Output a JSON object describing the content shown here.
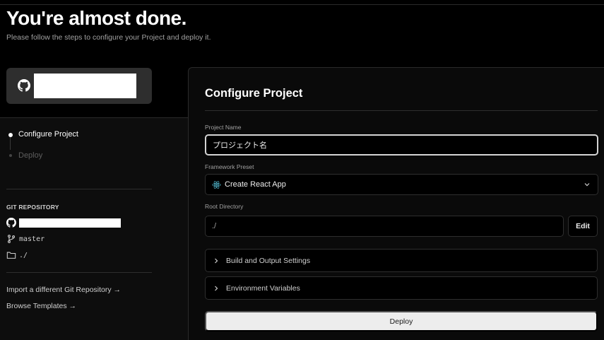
{
  "header": {
    "title": "You're almost done.",
    "subtitle": "Please follow the steps to configure your Project and deploy it."
  },
  "icons": {
    "repo_card": "github-icon",
    "repo_row": "github-icon",
    "branch_row": "git-branch-icon",
    "directory_row": "folder-icon",
    "framework": "react-icon",
    "select_caret": "chevron-down-icon",
    "accordion_caret": "chevron-right-icon"
  },
  "steps": [
    {
      "label": "Configure Project",
      "state": "active"
    },
    {
      "label": "Deploy",
      "state": "pending"
    }
  ],
  "git": {
    "heading": "GIT REPOSITORY",
    "branch": "master",
    "directory": "./"
  },
  "links": {
    "import": "Import a different Git Repository →",
    "templates": "Browse Templates →"
  },
  "config": {
    "title": "Configure Project",
    "project_name_label": "Project Name",
    "project_name_value": "プロジェクト名",
    "framework_label": "Framework Preset",
    "framework_value": "Create React App",
    "root_dir_label": "Root Directory",
    "root_dir_value": "./",
    "edit_label": "Edit",
    "build_settings_label": "Build and Output Settings",
    "env_vars_label": "Environment Variables",
    "deploy_label": "Deploy"
  },
  "colors": {
    "background": "#000000",
    "panel": "#0a0a0a",
    "deploy_button": "#ededed",
    "react_logo": "#58c4dc"
  }
}
